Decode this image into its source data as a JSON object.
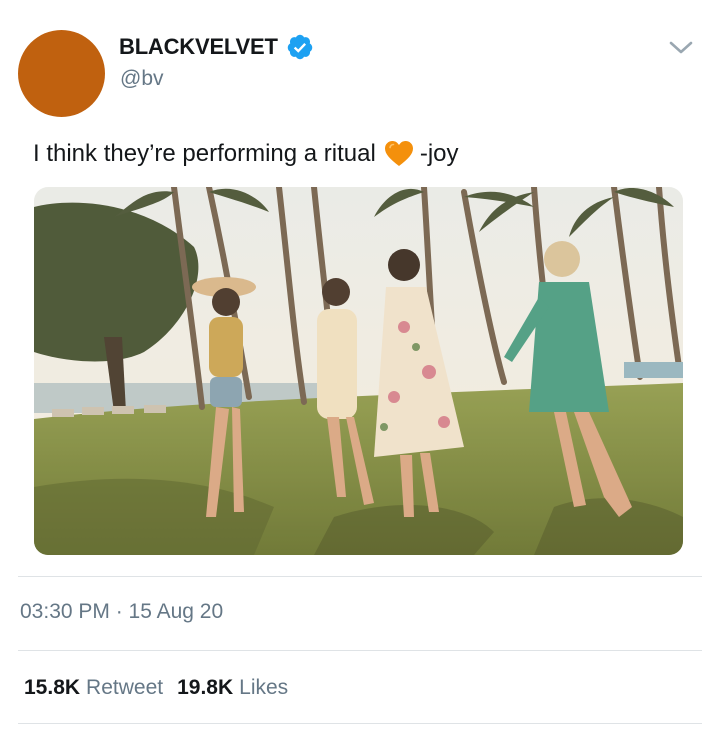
{
  "tweet": {
    "author": {
      "display_name": "BLACKVELVET",
      "handle": "@bv",
      "verified": true,
      "avatar_color": "#c0610f"
    },
    "text_before_emoji": "I think they’re performing a ritual",
    "emoji": "orange-heart-icon",
    "text_after_emoji": "-joy",
    "timestamp": "03:30 PM · 15 Aug 20",
    "stats": {
      "retweets_count": "15.8K",
      "retweets_label": "Retweet",
      "likes_count": "19.8K",
      "likes_label": "Likes"
    }
  },
  "colors": {
    "verified_blue": "#1da1f2",
    "muted_text": "#657786",
    "heart_orange": "#f4900c"
  },
  "icons": {
    "verified": "verified-badge-icon",
    "menu": "chevron-down-icon"
  }
}
